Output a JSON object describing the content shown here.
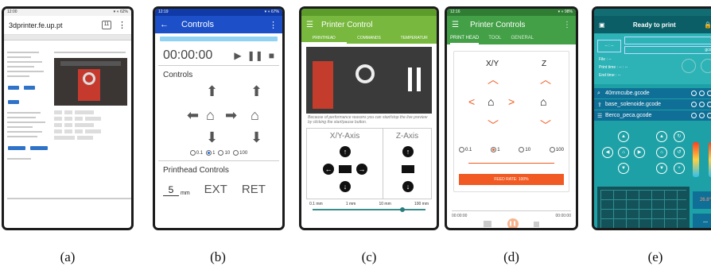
{
  "captions": [
    "(a)",
    "(b)",
    "(c)",
    "(d)",
    "(e)"
  ],
  "a": {
    "status_time": "12:00",
    "status_right": "▾ ⋄ 62%",
    "url": "3dprinter.fe.up.pt",
    "tabs_count": "11",
    "menu_icon": "⋮"
  },
  "b": {
    "status_time": "12:19",
    "status_right": "▾ ⋄ 67%",
    "title": "Controls",
    "timer": "00:00:00",
    "controls_heading": "Controls",
    "steps": [
      "0.1",
      "1",
      "10",
      "100"
    ],
    "selected_step": "1",
    "printhead_heading": "Printhead Controls",
    "extrude_amount": "5",
    "unit": "mm",
    "extrude_label": "EXT",
    "retract_label": "RET"
  },
  "c": {
    "title": "Printer Control",
    "tabs": [
      "PRINTHEAD",
      "COMMANDS",
      "TEMPERATUR"
    ],
    "note": "Because of performance reasons you can start/stop the live preview by clicking the start/pause button.",
    "xy_label": "X/Y-Axis",
    "z_label": "Z-Axis",
    "scale": [
      "0.1 mm",
      "1 mm",
      "10 mm",
      "100 mm"
    ]
  },
  "d": {
    "status_time": "12:16",
    "status_right": "▾ ⋄ 98%",
    "title": "Printer Controls",
    "tabs": [
      "PRINT HEAD",
      "TOOL",
      "GENERAL"
    ],
    "xy_label": "X/Y",
    "z_label": "Z",
    "steps": [
      "0.1",
      "1",
      "10",
      "100"
    ],
    "selected_step": "1",
    "feed_rate": "FEED RATE: 100%",
    "time_left": "00:00:00",
    "time_right": "00:00:00"
  },
  "e": {
    "title": "Ready to print",
    "dash": "-- : --",
    "field_1": "1m",
    "field_2": "gcode",
    "file_label": "File : --",
    "print_time": "Print time : -- : --",
    "end_time": "End time : --",
    "files": [
      "40mmcube.gcode",
      "base_solenoide.gcode",
      "Berco_peca.gcode"
    ],
    "temp_reading": "26.8°",
    "temp_dash": "—"
  }
}
